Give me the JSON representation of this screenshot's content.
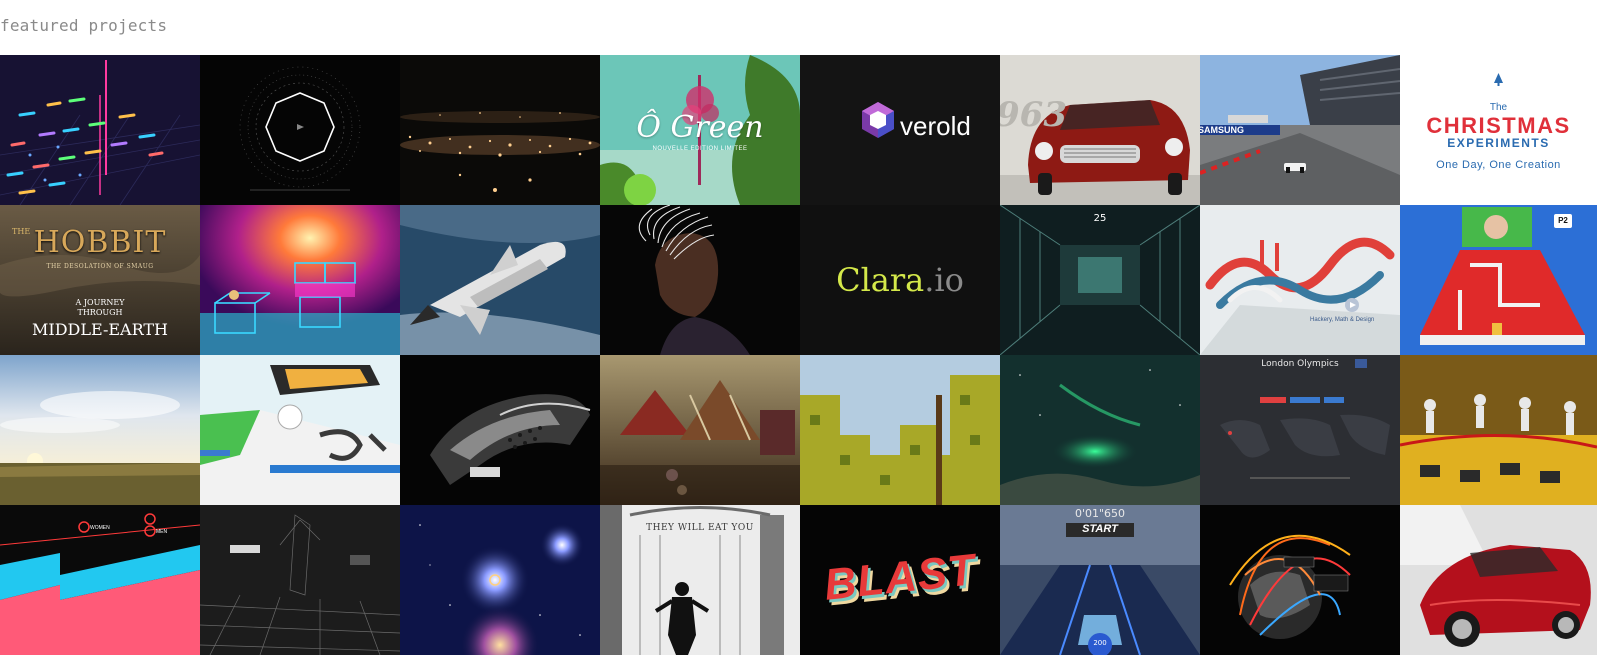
{
  "page": {
    "heading": "featured projects"
  },
  "tiles": {
    "ogreen": {
      "title": "Ô Green",
      "subtitle": "NOUVELLE EDITION LIMITEE"
    },
    "verold": {
      "name": "verold"
    },
    "aston": {
      "badge": "963"
    },
    "racing": {
      "sponsor": "SAMSUNG"
    },
    "christmas": {
      "the": "The",
      "title": "CHRISTMAS",
      "subtitle": "EXPERIMENTS",
      "tagline": "One Day, One Creation"
    },
    "hobbit": {
      "title": "HOBBIT",
      "prefix": "THE",
      "subtitle": "THE DESOLATION OF SMAUG",
      "line1": "A JOURNEY",
      "line2": "THROUGH",
      "line3": "MIDDLE-EARTH"
    },
    "clara": {
      "name_a": "Clara",
      "name_b": ".io"
    },
    "corridor": {
      "counter": "25"
    },
    "hackery": {
      "caption": "Hackery, Math & Design"
    },
    "pong": {
      "badge": "P2"
    },
    "olympics": {
      "title": "London Olympics"
    },
    "running": {
      "labels": [
        "WOMEN",
        "MEN"
      ]
    },
    "eat": {
      "title": "THEY WILL EAT YOU"
    },
    "blast": {
      "word": "BLAST"
    },
    "race": {
      "timer": "0'01\"650",
      "start": "START",
      "speed": "200"
    }
  }
}
